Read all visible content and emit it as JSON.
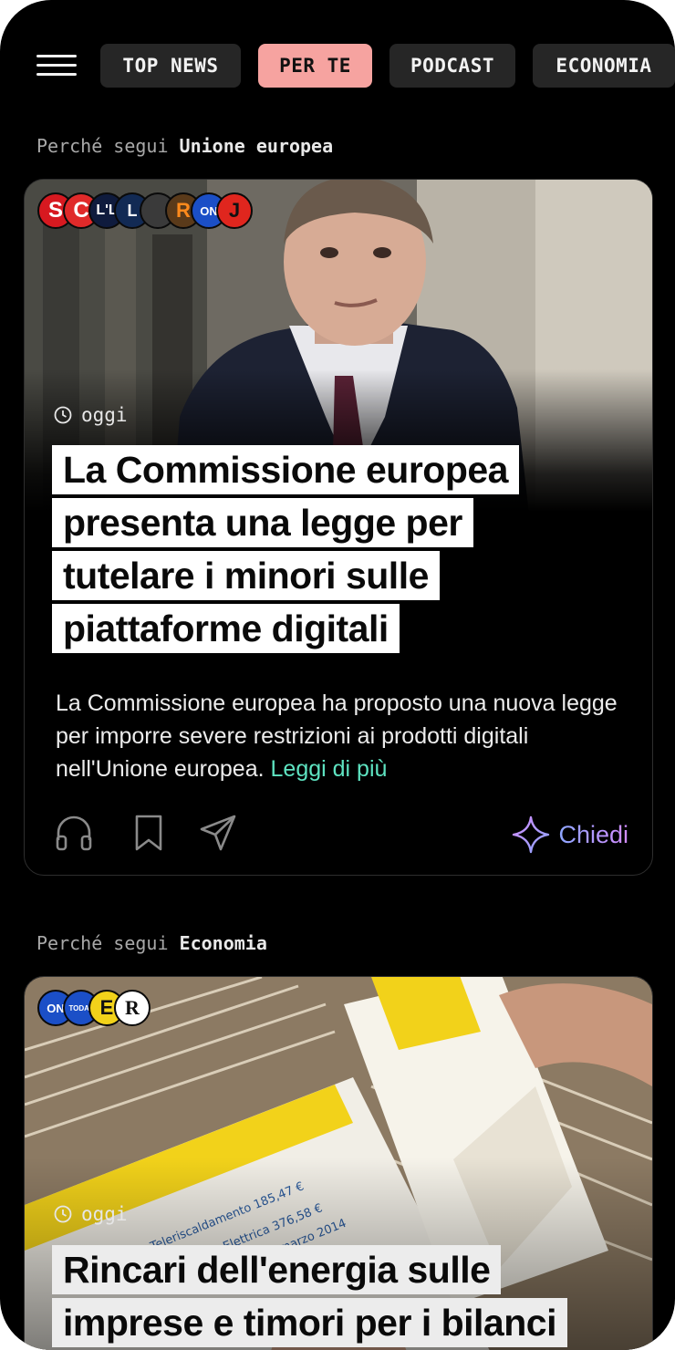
{
  "nav": {
    "tabs": [
      {
        "label": "TOP NEWS",
        "active": false
      },
      {
        "label": "PER TE",
        "active": true
      },
      {
        "label": "PODCAST",
        "active": false
      },
      {
        "label": "ECONOMIA",
        "active": false
      }
    ]
  },
  "feed": [
    {
      "reason_prefix": "Perché segui",
      "reason_topic": "Unione europea",
      "time": "oggi",
      "headline": "La Commissione europea presenta una legge per tutelare i minori sulle piattaforme digitali",
      "summary": "La Commissione europea ha proposto una nuova legge per imporre severe restrizioni ai prodotti digitali nell'Unione europea.",
      "read_more": "Leggi di più",
      "ask_label": "Chiedi",
      "sources": [
        "S",
        "C",
        "L'L",
        "L",
        "",
        "R",
        "ON",
        "J"
      ]
    },
    {
      "reason_prefix": "Perché segui",
      "reason_topic": "Economia",
      "time": "oggi",
      "headline": "Rincari dell'energia sulle imprese e timori per i bilanci",
      "sources": [
        "ON",
        "TODAY",
        "E",
        "R"
      ]
    }
  ],
  "colors": {
    "accent_tab": "#f6a3a0",
    "read_more": "#5ee3c1",
    "ask_gradient_start": "#8da6ff",
    "ask_gradient_end": "#d38cff"
  }
}
